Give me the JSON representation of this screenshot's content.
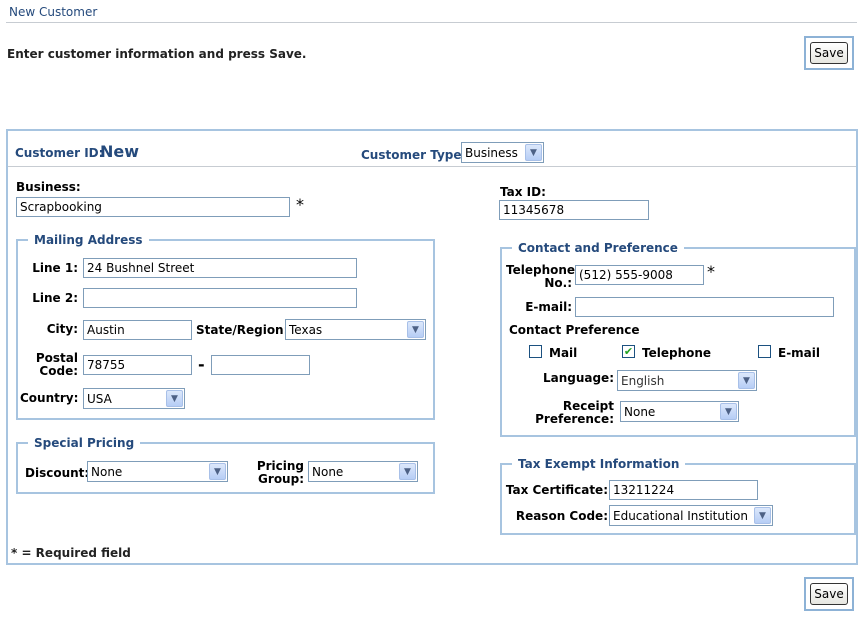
{
  "page_title": "New Customer",
  "instructions": "Enter customer information and press Save.",
  "save_label": "Save",
  "customer": {
    "id_label": "Customer ID:",
    "id_value": "New",
    "type_label": "Customer Type:",
    "type_value": "Business"
  },
  "business": {
    "label": "Business:",
    "value": "Scrapbooking",
    "required_mark": "*"
  },
  "tax": {
    "label": "Tax ID:",
    "value": "11345678"
  },
  "mailing": {
    "legend": "Mailing Address",
    "line1_label": "Line 1:",
    "line1_value": "24 Bushnel Street",
    "line2_label": "Line 2:",
    "line2_value": "",
    "city_label": "City:",
    "city_value": "Austin",
    "state_label": "State/Region:",
    "state_value": "Texas",
    "postal_label_1": "Postal",
    "postal_label_2": "Code:",
    "postal_value": "78755",
    "postal_dash": "-",
    "postal_ext_value": "",
    "country_label": "Country:",
    "country_value": "USA"
  },
  "contact": {
    "legend": "Contact and Preference",
    "phone_label_1": "Telephone",
    "phone_label_2": "No.:",
    "phone_value": "(512) 555-9008",
    "phone_required_mark": "*",
    "email_label": "E-mail:",
    "email_value": "",
    "pref_title": "Contact Preference",
    "mail_label": "Mail",
    "mail_checked": false,
    "telephone_label": "Telephone",
    "telephone_checked": true,
    "email_pref_label": "E-mail",
    "email_pref_checked": false,
    "language_label": "Language:",
    "language_value": "English",
    "receipt_label_1": "Receipt",
    "receipt_label_2": "Preference:",
    "receipt_value": "None"
  },
  "pricing": {
    "legend": "Special Pricing",
    "discount_label": "Discount:",
    "discount_value": "None",
    "group_label_1": "Pricing",
    "group_label_2": "Group:",
    "group_value": "None"
  },
  "exempt": {
    "legend": "Tax Exempt Information",
    "cert_label": "Tax Certificate:",
    "cert_value": "13211224",
    "reason_label": "Reason Code:",
    "reason_value": "Educational Institution"
  },
  "required_note": "* = Required field",
  "colors": {
    "heading": "#254a7c",
    "border": "#a7c4e0",
    "input_border": "#7f9db9",
    "check": "#21a121"
  },
  "icons": {
    "dropdown": "chevron-down-icon",
    "check": "checkmark-icon"
  }
}
